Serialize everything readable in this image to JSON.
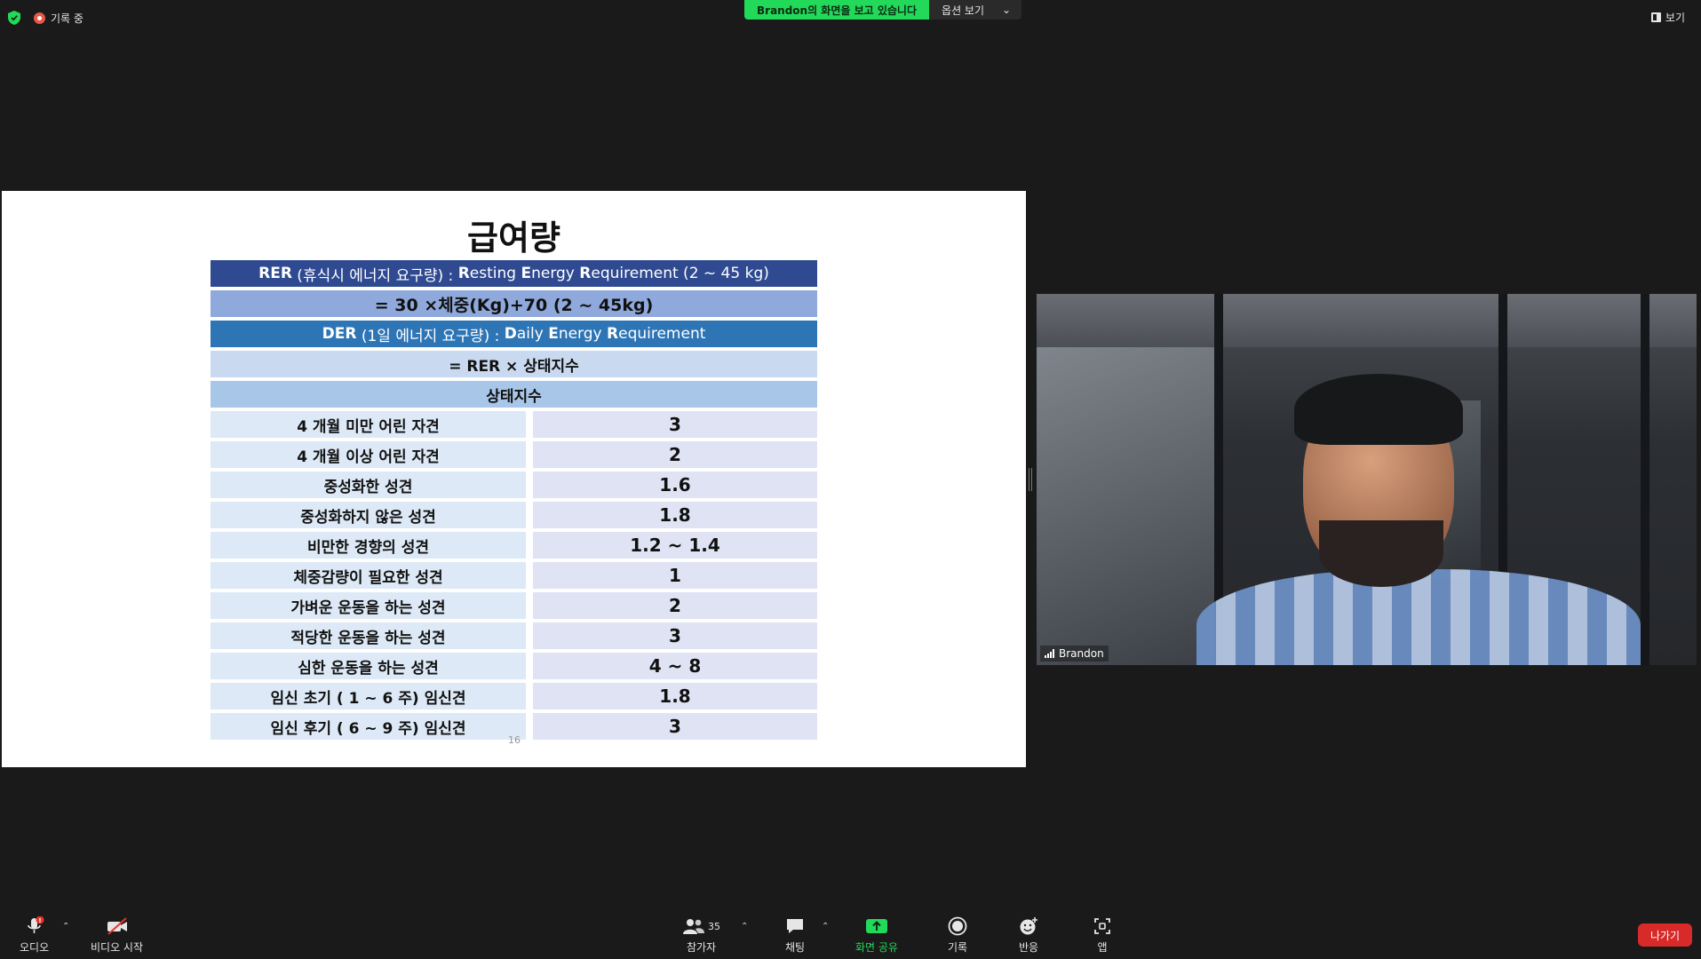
{
  "top": {
    "recording_label": "기록 중",
    "share_banner": "Brandon의 화면을 보고 있습니다",
    "view_options": "옵션 보기",
    "view_button": "보기"
  },
  "slide": {
    "title": "급여량",
    "rer_prefix": "RER",
    "rer_desc": " (휴식시 에너지 요구량) : ",
    "rer_en": {
      "r": "R",
      "r_rest": "esting ",
      "e": "E",
      "e_rest": "nergy ",
      "req": "R",
      "req_rest": "equirement (2 ~ 45 kg)"
    },
    "rer_formula": "= 30 ×체중(Kg)+70 (2 ~ 45kg)",
    "der_prefix": "DER",
    "der_desc": " (1일 에너지 요구량) : ",
    "der_en": {
      "d": "D",
      "d_rest": "aily ",
      "e": "E",
      "e_rest": "nergy ",
      "req": "R",
      "req_rest": "equirement"
    },
    "der_formula": "= RER × 상태지수",
    "factor_header": "상태지수",
    "rows": [
      {
        "label": "4 개월 미만 어린 자견",
        "value": "3"
      },
      {
        "label": "4 개월 이상 어린 자견",
        "value": "2"
      },
      {
        "label": "중성화한 성견",
        "value": "1.6"
      },
      {
        "label": "중성화하지 않은 성견",
        "value": "1.8"
      },
      {
        "label": "비만한 경향의 성견",
        "value": "1.2 ~ 1.4"
      },
      {
        "label": "체중감량이 필요한 성견",
        "value": "1"
      },
      {
        "label": "가벼운 운동을 하는 성견",
        "value": "2"
      },
      {
        "label": "적당한 운동을 하는 성견",
        "value": "3"
      },
      {
        "label": "심한 운동을 하는 성견",
        "value": "4 ~ 8"
      },
      {
        "label": "임신 초기 ( 1 ~ 6 주) 임신견",
        "value": "1.8"
      },
      {
        "label": "임신 후기 ( 6 ~ 9 주) 임신견",
        "value": "3"
      }
    ],
    "page_number": "16"
  },
  "video": {
    "participant_name": "Brandon"
  },
  "toolbar": {
    "audio": "오디오",
    "video": "비디오 시작",
    "participants": "참가자",
    "participants_count": "35",
    "chat": "채팅",
    "share": "화면 공유",
    "record": "기록",
    "reactions": "반응",
    "apps": "앱",
    "leave": "나가기"
  },
  "colors": {
    "share_green": "#23d959",
    "leave_red": "#d92a2a",
    "header_dark_blue": "#2f4a91",
    "header_blue": "#2e75b6"
  }
}
